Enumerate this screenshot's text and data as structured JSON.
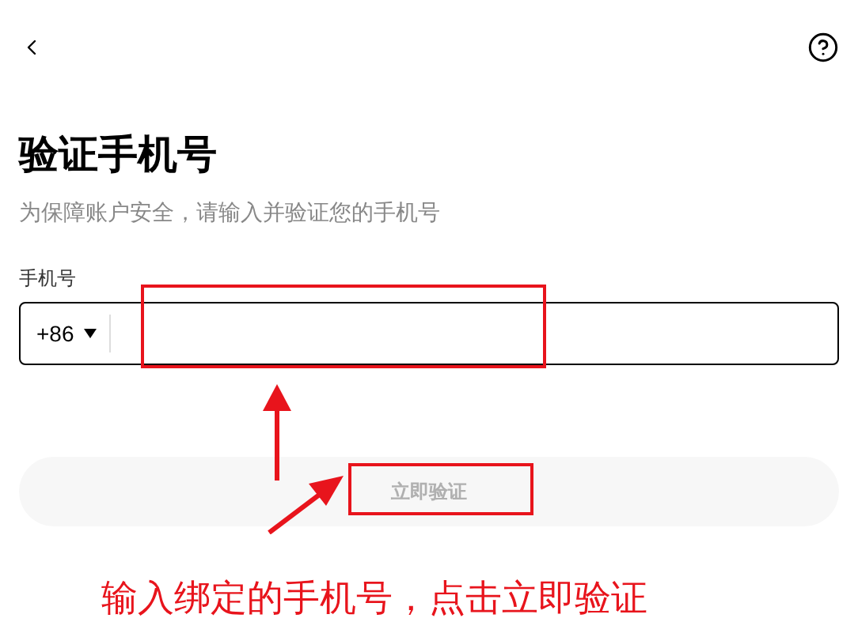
{
  "title": "验证手机号",
  "subtitle": "为保障账户安全，请输入并验证您的手机号",
  "phone_field": {
    "label": "手机号",
    "country_code": "+86"
  },
  "submit_button": {
    "label": "立即验证",
    "disabled": true
  },
  "annotation": {
    "text": "输入绑定的手机号，点击立即验证"
  }
}
